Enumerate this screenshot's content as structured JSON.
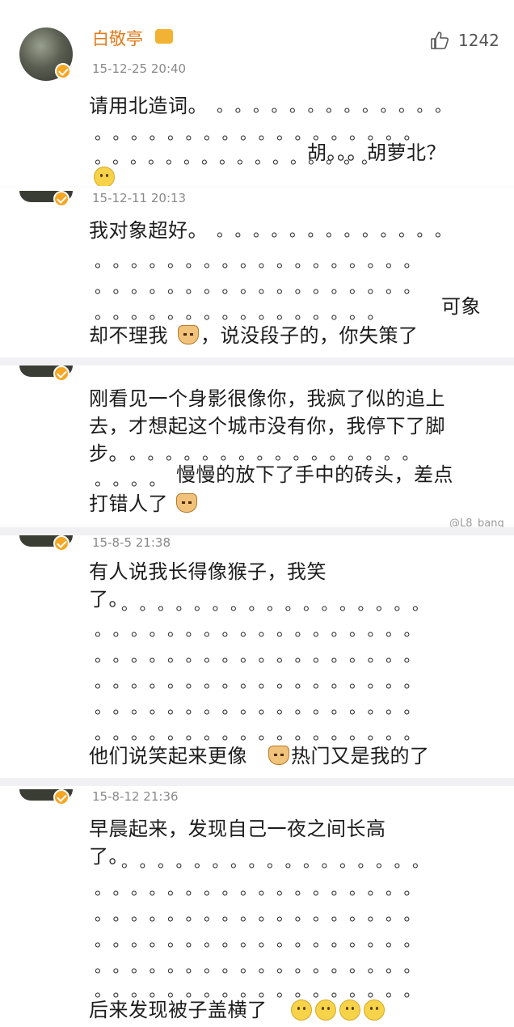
{
  "posts": [
    {
      "name": "白敬亭",
      "time": "15-12-25 20:40",
      "like_count": "1242",
      "lines": [
        "请用北造词。",
        "胡。。。胡萝北？"
      ]
    },
    {
      "time": "15-12-11 20:13",
      "lines": [
        "我对象超好。",
        "可象",
        "却不理我",
        "，说没段子的，你失策了"
      ]
    },
    {
      "lines": [
        "刚看见一个身影很像你，我疯了似的追上",
        "去，才想起这个城市没有你，我停下了脚",
        "步。",
        "慢慢的放下了手中的砖头，差点",
        "打错人了"
      ]
    },
    {
      "time": "15-8-5 21:38",
      "lines": [
        "有人说我长得像猴子，我笑",
        "了。",
        "他们说笑起来更像",
        "热门又是我的了"
      ]
    },
    {
      "time": "15-8-12 21:36",
      "lines": [
        "早晨起来，发现自己一夜之间长高",
        "了。",
        "后来发现被子盖横了"
      ]
    }
  ],
  "watermark": "@L8_bang",
  "dots": {
    "d6": "。。。。。。。。。。。。。。。。",
    "full": "。。。。。。。。。。。。。。。。。。",
    "d12": "。。。。。。。。。。。。。",
    "d14": "。。。。。。。。。。。。。。。。",
    "d15": "。。。。。。。。。。。。。。。。。",
    "d4": "。。。。",
    "d16": "。。。。。。。。。。。。。。。。"
  },
  "icons": {
    "avatar": "avatar-icon",
    "verified": "verified-badge-icon",
    "vip": "vip-icon",
    "like": "thumbs-up-icon",
    "emoji": "smile-emoji-icon",
    "cat": "cat-emoji-icon"
  },
  "colors": {
    "name": "#e07a1a",
    "verified": "#f5a623",
    "time": "#8a8a8a"
  }
}
